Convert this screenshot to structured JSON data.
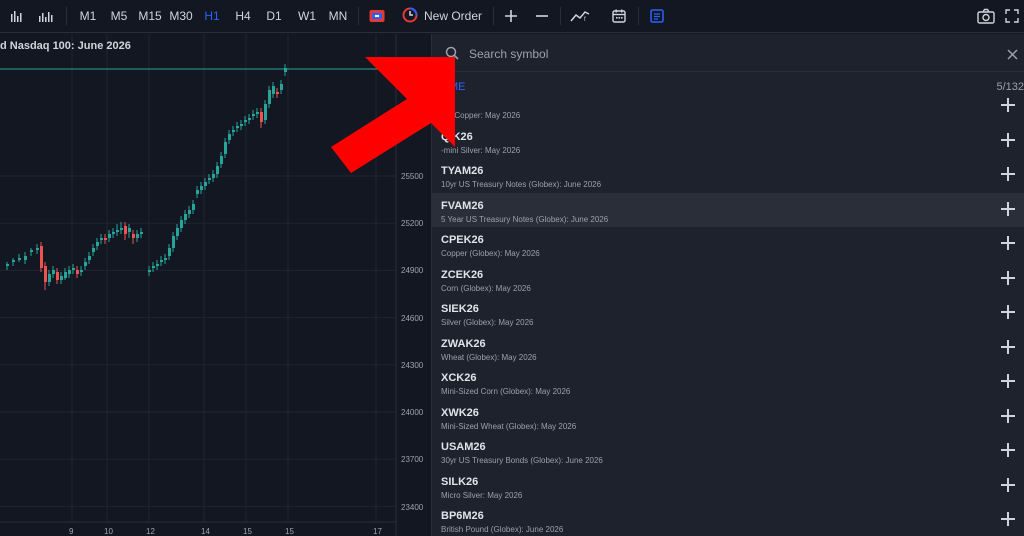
{
  "toolbar": {
    "timeframes": [
      "M1",
      "M5",
      "M15",
      "M30",
      "H1",
      "H4",
      "D1",
      "W1",
      "MN"
    ],
    "active_timeframe": "H1",
    "new_order_label": "New Order"
  },
  "chart": {
    "title": "d Nasdaq 100: June 2026",
    "y_ticks": [
      "25500",
      "25200",
      "24900",
      "24600",
      "24300",
      "24000",
      "23700",
      "23400"
    ],
    "x_ticks": [
      "9",
      "10",
      "12",
      "14",
      "15",
      "15",
      "17"
    ],
    "colors": {
      "up": "#26a69a",
      "down": "#ef5350",
      "last_price_line": "#26a69a"
    }
  },
  "symbol_panel": {
    "search_placeholder": "Search symbol",
    "group": {
      "name": "CME",
      "count": "5/132"
    },
    "items": [
      {
        "symbol": "",
        "description": "cro Copper: May 2026"
      },
      {
        "symbol": "QIK26",
        "description": "-mini Silver: May 2026"
      },
      {
        "symbol": "TYAM26",
        "description": "10yr US Treasury Notes (Globex): June 2026"
      },
      {
        "symbol": "FVAM26",
        "description": "5 Year US Treasury Notes (Globex): June 2026",
        "highlighted": true
      },
      {
        "symbol": "CPEK26",
        "description": "Copper (Globex): May 2026"
      },
      {
        "symbol": "ZCEK26",
        "description": "Corn (Globex): May 2026"
      },
      {
        "symbol": "SIEK26",
        "description": "Silver (Globex): May 2026"
      },
      {
        "symbol": "ZWAK26",
        "description": "Wheat (Globex): May 2026"
      },
      {
        "symbol": "XCK26",
        "description": "Mini-Sized Corn (Globex): May 2026"
      },
      {
        "symbol": "XWK26",
        "description": "Mini-Sized Wheat (Globex): May 2026"
      },
      {
        "symbol": "USAM26",
        "description": "30yr US Treasury Bonds (Globex): June 2026"
      },
      {
        "symbol": "SILK26",
        "description": "Micro Silver: May 2026"
      },
      {
        "symbol": "BP6M26",
        "description": "British Pound (Globex): June 2026"
      }
    ]
  },
  "overlay": {
    "arrow_color": "#ff0000"
  }
}
